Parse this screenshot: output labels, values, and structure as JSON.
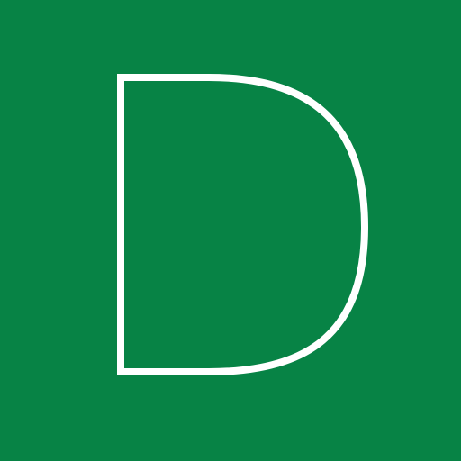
{
  "icon": {
    "name": "letter-d-outline-icon",
    "letter": "D",
    "background_color": "#078345",
    "stroke_color": "#ffffff"
  }
}
